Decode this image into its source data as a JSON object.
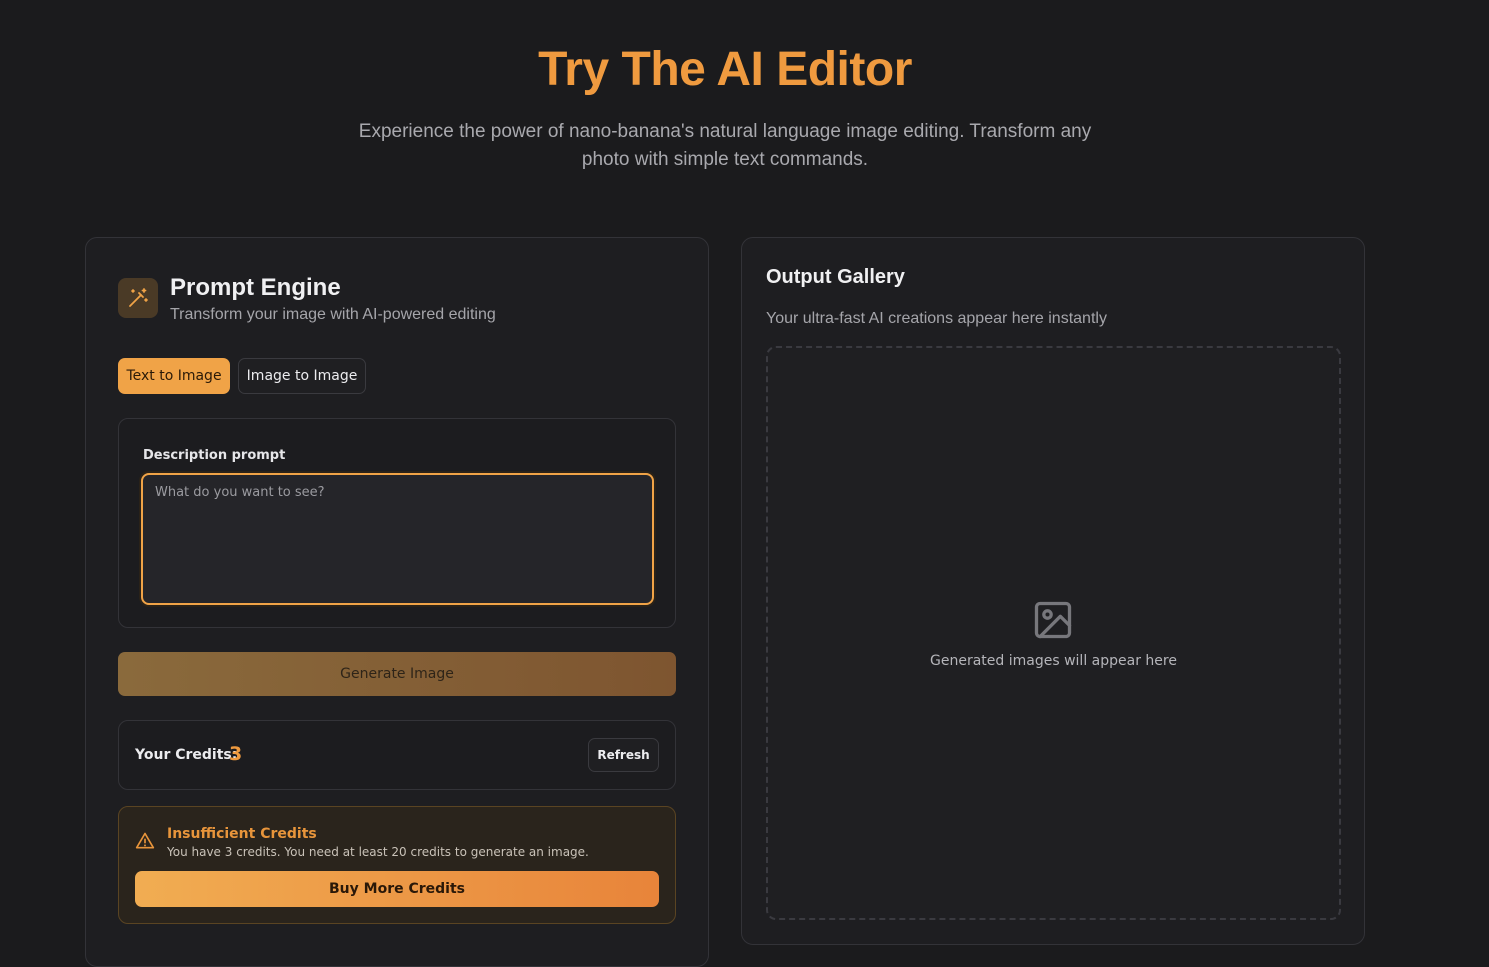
{
  "hero": {
    "title": "Try The AI Editor",
    "subtitle": "Experience the power of nano-banana's natural language image editing. Transform any photo with simple text commands."
  },
  "prompt_engine": {
    "icon": "magic-wand-icon",
    "title": "Prompt Engine",
    "subtitle": "Transform your image with AI-powered editing",
    "tabs": [
      {
        "label": "Text to Image",
        "active": true
      },
      {
        "label": "Image to Image",
        "active": false
      }
    ],
    "prompt_label": "Description prompt",
    "prompt_placeholder": "What do you want to see?",
    "prompt_value": "",
    "generate_label": "Generate Image",
    "credits": {
      "label": "Your Credits:",
      "value": "3",
      "refresh_label": "Refresh"
    },
    "warning": {
      "icon": "warning-triangle-icon",
      "title": "Insufficient Credits",
      "text": "You have 3 credits. You need at least 20 credits to generate an image.",
      "buy_label": "Buy More Credits"
    }
  },
  "gallery": {
    "title": "Output Gallery",
    "subtitle": "Your ultra-fast AI creations appear here instantly",
    "empty_icon": "image-placeholder-icon",
    "empty_text": "Generated images will appear here"
  },
  "colors": {
    "accent": "#ef9a3f",
    "background": "#1b1b1d",
    "panel": "#1e1e21"
  }
}
